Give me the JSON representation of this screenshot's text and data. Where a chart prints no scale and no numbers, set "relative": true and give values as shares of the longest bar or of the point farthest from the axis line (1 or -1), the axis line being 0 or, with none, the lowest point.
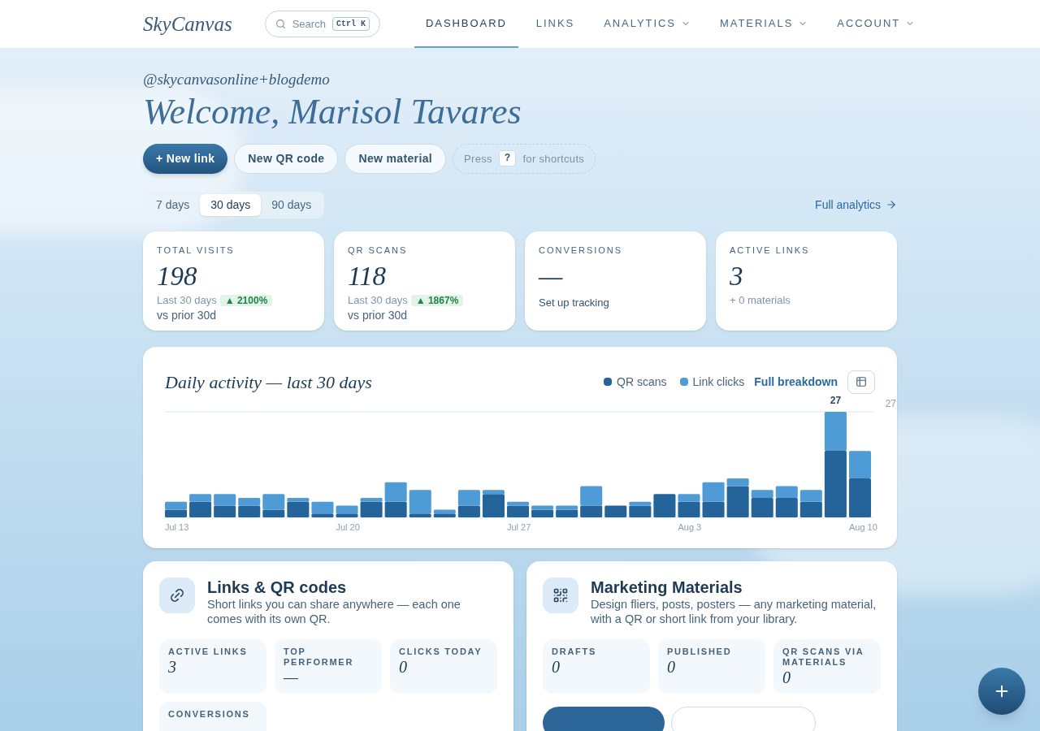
{
  "brand": "SkyCanvas",
  "search": {
    "placeholder": "Search",
    "shortcut": "Ctrl K"
  },
  "nav": [
    {
      "label": "DASHBOARD",
      "selected": true,
      "has_menu": false
    },
    {
      "label": "LINKS",
      "selected": false,
      "has_menu": false
    },
    {
      "label": "ANALYTICS",
      "selected": false,
      "has_menu": true
    },
    {
      "label": "MATERIALS",
      "selected": false,
      "has_menu": true
    },
    {
      "label": "ACCOUNT",
      "selected": false,
      "has_menu": true
    }
  ],
  "handle": "@skycanvasonline+blogdemo",
  "greeting": "Welcome, Marisol Tavares",
  "actions": [
    {
      "label": "New link",
      "icon": "+",
      "kind": "primary"
    },
    {
      "label": "New QR code",
      "kind": "secondary"
    },
    {
      "label": "New material",
      "kind": "secondary"
    }
  ],
  "shortcut_hint": {
    "before": "Press",
    "key": "?",
    "after": "for shortcuts"
  },
  "ranges": [
    {
      "label": "7 days",
      "selected": false
    },
    {
      "label": "30 days",
      "selected": true
    },
    {
      "label": "90 days",
      "selected": false
    }
  ],
  "full_analytics": "Full analytics",
  "stats": [
    {
      "label": "TOTAL VISITS",
      "value": "198",
      "note": "Last 30 days",
      "change": "▲ 2100%",
      "suffix": "vs prior 30d"
    },
    {
      "label": "QR SCANS",
      "value": "118",
      "note": "Last 30 days",
      "change": "▲ 1867%",
      "suffix": "vs prior 30d"
    },
    {
      "label": "CONVERSIONS",
      "value": "—",
      "link": "Set up tracking"
    },
    {
      "label": "ACTIVE LINKS",
      "value": "3",
      "note": "+ 0 materials"
    }
  ],
  "activity": {
    "title": "Daily activity — last 30 days",
    "breakdown": "Full breakdown",
    "chart_data": {
      "type": "bar",
      "stacked": true,
      "relative": true,
      "categories": [
        "Jul 13",
        null,
        null,
        null,
        null,
        null,
        null,
        "Jul 20",
        null,
        null,
        null,
        null,
        null,
        null,
        "Jul 27",
        null,
        null,
        null,
        null,
        null,
        null,
        "Aug 3",
        null,
        null,
        null,
        null,
        null,
        null,
        "Aug 10"
      ],
      "annotations": [
        "27",
        "27"
      ],
      "series": [
        {
          "name": "QR scans",
          "color": "#24649a",
          "values": [
            0.074,
            0.148,
            0.111,
            0.111,
            0.074,
            0.148,
            0.037,
            0.037,
            0.148,
            0.148,
            0.037,
            0.037,
            0.111,
            0.222,
            0.111,
            0.074,
            0.074,
            0.111,
            0.111,
            0.111,
            0.222,
            0.148,
            0.148,
            0.296,
            0.185,
            0.185,
            0.148,
            0.63,
            0.37
          ]
        },
        {
          "name": "Link clicks",
          "color": "#4f9bd6",
          "values": [
            0.074,
            0.074,
            0.111,
            0.074,
            0.148,
            0.037,
            0.111,
            0.074,
            0.037,
            0.185,
            0.222,
            0.037,
            0.148,
            0.037,
            0.037,
            0.037,
            0.037,
            0.185,
            0,
            0.037,
            0,
            0.074,
            0.185,
            0.074,
            0.074,
            0.111,
            0.111,
            0.37,
            0.259
          ]
        }
      ]
    }
  },
  "panels": [
    {
      "title": "Links & QR codes",
      "description": "Short links you can share anywhere — each one comes with its own QR.",
      "tiles": [
        {
          "label": "ACTIVE LINKS",
          "value": "3"
        },
        {
          "label": "TOP PERFORMER",
          "value": "—"
        },
        {
          "label": "CLICKS TODAY",
          "value": "0"
        },
        {
          "label": "CONVERSIONS"
        }
      ]
    },
    {
      "title": "Marketing Materials",
      "description": "Design fliers, posts, posters — any marketing material, with a QR or short link from your library.",
      "tiles": [
        {
          "label": "DRAFTS",
          "value": "0"
        },
        {
          "label": "PUBLISHED",
          "value": "0"
        },
        {
          "label": "QR SCANS VIA MATERIALS",
          "value": "0"
        }
      ],
      "buttons": [
        {
          "kind": "primary"
        },
        {
          "kind": "secondary"
        }
      ]
    }
  ]
}
